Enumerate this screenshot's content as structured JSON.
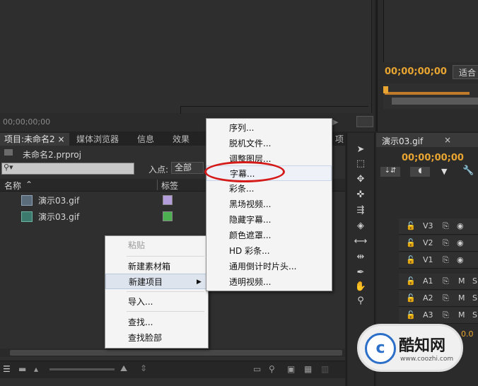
{
  "source_monitor": {
    "timecode": "00;00;00;00"
  },
  "program_monitor": {
    "timecode": "00;00;00;00",
    "fit_label": "适合"
  },
  "project_panel": {
    "tabs": [
      "项目:未命名2",
      "媒体浏览器",
      "信息",
      "效果"
    ],
    "tab_close": "×",
    "file_name": "未命名2.prproj",
    "search_placeholder": "",
    "inpoint_label": "入点:",
    "inpoint_value": "全部",
    "columns": {
      "name": "名称",
      "label": "标签"
    },
    "items": [
      {
        "name": "演示03.gif",
        "label_color": "#b39ddb"
      },
      {
        "name": "演示03.gif",
        "label_color": "#4caf50"
      }
    ],
    "partial_tab_right": "项"
  },
  "context_menu": {
    "items": [
      "粘贴",
      "新建素材箱",
      "新建项目",
      "导入...",
      "查找...",
      "查找脸部"
    ]
  },
  "submenu": {
    "items": [
      "序列...",
      "脱机文件...",
      "调整图层...",
      "字幕...",
      "彩条...",
      "黑场视频...",
      "隐藏字幕...",
      "颜色遮罩...",
      "HD 彩条...",
      "通用倒计时片头...",
      "透明视频..."
    ]
  },
  "timeline": {
    "tab": "演示03.gif",
    "tab_close": "×",
    "timecode": "00;00;00;00",
    "video_tracks": [
      "V3",
      "V2",
      "V1"
    ],
    "audio_tracks": [
      "A1",
      "A2",
      "A3"
    ],
    "audio_buttons": [
      "M",
      "S"
    ],
    "partial_value": "0.0"
  },
  "watermark": {
    "logo_char": "c",
    "title": "酷知网",
    "url": "www.coozhi.com"
  }
}
